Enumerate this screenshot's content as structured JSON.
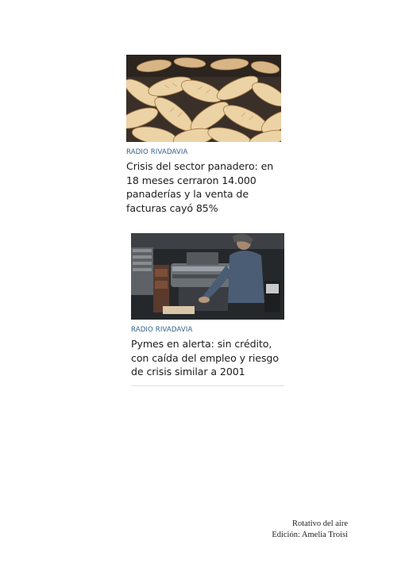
{
  "articles": [
    {
      "source": "RADIO RIVADAVIA",
      "headline": "Crisis del sector panadero: en 18 meses cerraron 14.000 panaderías y la venta de facturas cayó 85%",
      "image_icon": "bread-photo"
    },
    {
      "source": "RADIO RIVADAVIA",
      "headline": "Pymes en alerta: sin crédito, con caída del empleo y riesgo de crisis similar a 2001",
      "image_icon": "factory-worker-photo"
    }
  ],
  "footer": {
    "line1": "Rotativo del aire",
    "line2": "Edición: Amelia Troisi"
  }
}
